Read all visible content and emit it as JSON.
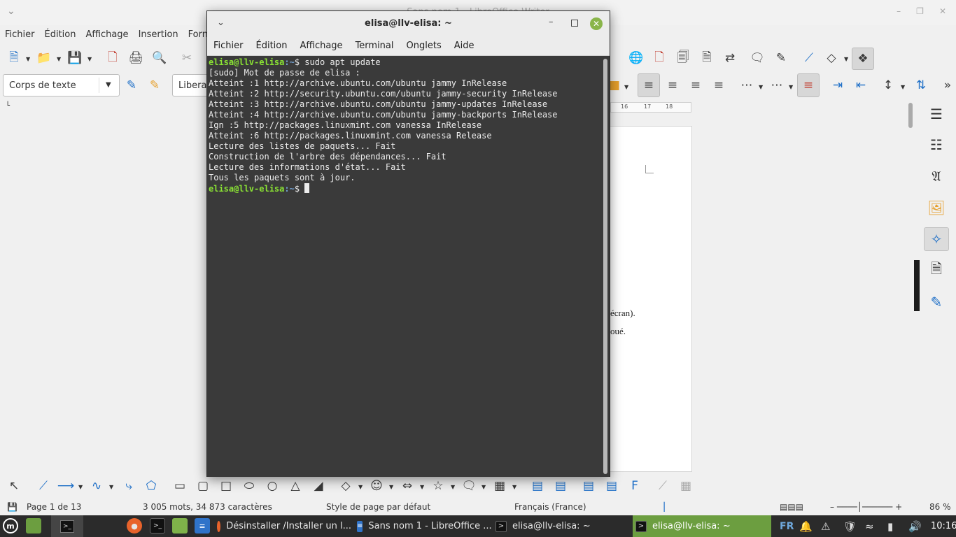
{
  "libreoffice": {
    "title": "Sans nom 1 - LibreOffice Writer",
    "menu": [
      "Fichier",
      "Édition",
      "Affichage",
      "Insertion",
      "Form"
    ],
    "paragraph_style": "Corps de texte",
    "font_name": "Liberation Serif",
    "ruler_ticks": [
      "16",
      "17",
      "18"
    ],
    "doc_text_1": "écran).",
    "doc_text_2": "oué.",
    "status": {
      "page": "Page 1 de 13",
      "words": "3 005 mots, 34 873 caractères",
      "page_style": "Style de page par défaut",
      "language": "Français (France)",
      "zoom": "86 %"
    }
  },
  "terminal": {
    "title": "elisa@llv-elisa: ~",
    "menu": [
      "Fichier",
      "Édition",
      "Affichage",
      "Terminal",
      "Onglets",
      "Aide"
    ],
    "prompt_user": "elisa@llv-elisa",
    "prompt_path": ":~",
    "prompt_symbol": "$ ",
    "command": "sudo apt update",
    "output": [
      "[sudo] Mot de passe de elisa :",
      "Atteint :1 http://archive.ubuntu.com/ubuntu jammy InRelease",
      "Atteint :2 http://security.ubuntu.com/ubuntu jammy-security InRelease",
      "Atteint :3 http://archive.ubuntu.com/ubuntu jammy-updates InRelease",
      "Atteint :4 http://archive.ubuntu.com/ubuntu jammy-backports InRelease",
      "Ign :5 http://packages.linuxmint.com vanessa InRelease",
      "Atteint :6 http://packages.linuxmint.com vanessa Release",
      "Lecture des listes de paquets... Fait",
      "Construction de l'arbre des dépendances... Fait",
      "Lecture des informations d'état... Fait",
      "Tous les paquets sont à jour."
    ]
  },
  "taskbar": {
    "windows": [
      {
        "label": "Désinstaller /Installer un l...",
        "icon": "firefox-icon"
      },
      {
        "label": "Sans nom 1 - LibreOffice ...",
        "icon": "writer-icon"
      },
      {
        "label": "elisa@llv-elisa: ~",
        "icon": "terminal-icon"
      },
      {
        "label": "elisa@llv-elisa: ~",
        "icon": "terminal-icon"
      }
    ],
    "keyboard_layout": "FR",
    "clock": "10:16"
  },
  "colors": {
    "terminal_bg": "#3a3a3a",
    "prompt_user": "#8ae234",
    "prompt_path": "#729fcf",
    "taskbar_active": "#6c9e40",
    "mint_accent": "#8ab54a"
  }
}
